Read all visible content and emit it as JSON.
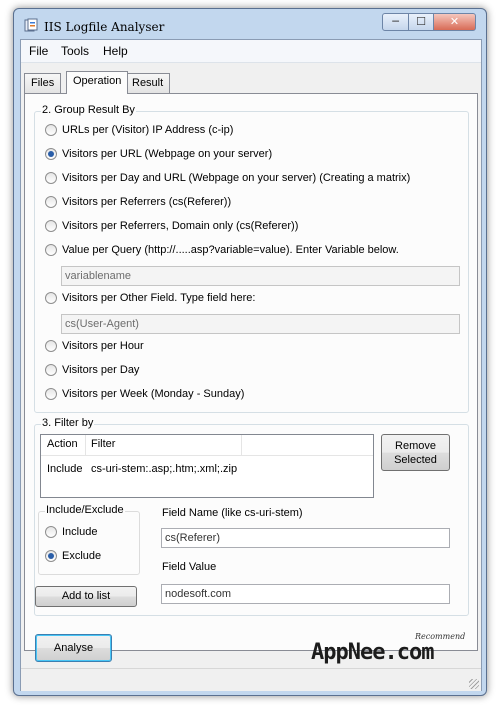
{
  "window": {
    "title": "IIS Logfile Analyser",
    "minimize": "─",
    "maximize": "☐",
    "close": "✕"
  },
  "menu": [
    "File",
    "Tools",
    "Help"
  ],
  "tabs": [
    "Files",
    "Operation",
    "Result"
  ],
  "group_by": {
    "legend": "2. Group Result By",
    "options": [
      "URLs per (Visitor) IP Address (c-ip)",
      "Visitors per URL (Webpage on your server)",
      "Visitors per Day and URL (Webpage on your server) (Creating a matrix)",
      "Visitors per Referrers (cs(Referer))",
      "Visitors per Referrers, Domain only (cs(Referer))",
      "Value per Query (http://.....asp?variable=value). Enter Variable below.",
      "Visitors per Other Field. Type field here:",
      "Visitors per Hour",
      "Visitors per Day",
      "Visitors per Week (Monday - Sunday)"
    ],
    "selected_index": 1,
    "variable_placeholder": "variablename",
    "other_field_placeholder": "cs(User-Agent)"
  },
  "filter": {
    "legend": "3. Filter by",
    "columns": [
      "Action",
      "Filter"
    ],
    "rows": [
      {
        "action": "Include",
        "filter": "cs-uri-stem:.asp;.htm;.xml;.zip"
      }
    ],
    "remove_line1": "Remove",
    "remove_line2": "Selected",
    "include_exclude_legend": "Include/Exclude",
    "include_label": "Include",
    "exclude_label": "Exclude",
    "selected": "Exclude",
    "field_name_label": "Field Name (like cs-uri-stem)",
    "field_name_value": "cs(Referer)",
    "field_value_label": "Field Value",
    "field_value_value": "nodesoft.com",
    "add_button": "Add to list"
  },
  "analyse_button": "Analyse",
  "watermark": {
    "brand": "AppNee.com",
    "tag": "Recommend"
  }
}
